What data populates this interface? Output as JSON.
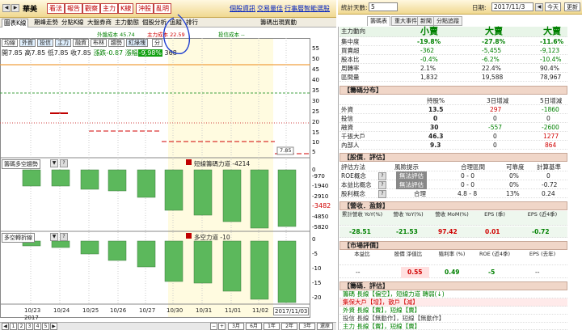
{
  "header": {
    "stock_name": "華美",
    "buttons": [
      "看法",
      "報告",
      "觀察",
      "主力",
      "K線",
      "沖股",
      "亂明"
    ],
    "links": [
      "個股資訊",
      "交易量佳",
      "行事曆",
      "智能選股"
    ]
  },
  "tabs": [
    "圖表K線",
    "期峰走勢",
    "分點K線",
    "大盤券商",
    "主力動態",
    "個股分析",
    "追蹤",
    "排行"
  ],
  "legend": {
    "item1": "外盤成本 45.74",
    "item2": "主力成本 22.59",
    "item3": "投信成本 --"
  },
  "chart_title": "籌碼出現異動",
  "toolbar": [
    "均線",
    "外資",
    "投信",
    "主力",
    "融資",
    "布林",
    "趨勢",
    "紅綠塊",
    "分"
  ],
  "price_line": {
    "open_label": "開",
    "open": "7.85",
    "high_label": "高",
    "high": "7.85",
    "low_label": "低",
    "low": "7.85",
    "close_label": "收",
    "close": "7.85",
    "change_label": "漲跌",
    "change": "-0.87",
    "pct_label": "漲幅",
    "pct": "-9.98%",
    "vol": "368"
  },
  "y_axis_price": [
    "55",
    "50",
    "45",
    "40",
    "35",
    "30",
    "25",
    "20",
    "15",
    "10",
    "5"
  ],
  "tag_price": "7.85",
  "panel2": {
    "select": "籌碼多空趨勢",
    "legend": "短線籌碼力道 -4214",
    "y": [
      "0",
      "-970",
      "-1940",
      "-2910",
      "-3482",
      "-4850",
      "-5820"
    ]
  },
  "panel3": {
    "select": "多空轉折線",
    "legend": "多空力道 -10",
    "y": [
      "0",
      "-5",
      "-10",
      "-15",
      "-20"
    ]
  },
  "x_axis": [
    "10/23",
    "10/24",
    "10/25",
    "10/26",
    "10/27",
    "10/30",
    "10/31",
    "11/01",
    "11/02"
  ],
  "x_year": "2017",
  "x_current": "2017/11/03",
  "bottom": {
    "pages": [
      "1",
      "2",
      "3",
      "4",
      "5"
    ],
    "ranges": [
      "3月",
      "6月",
      "1年",
      "2年",
      "3年",
      "還原"
    ]
  },
  "right": {
    "days_label": "統計天數:",
    "days": "5",
    "date_label": "日期:",
    "date": "2017/11/3",
    "today": "今天",
    "refresh": "更新",
    "rtabs": [
      "籌碼表",
      "重大事件",
      "新聞",
      "分點追蹤"
    ],
    "top_headers": [
      "小賣",
      "大賣",
      "大賣"
    ],
    "stats": [
      {
        "label": "主力動向",
        "v": [
          "",
          "",
          ""
        ]
      },
      {
        "label": "集中度",
        "v": [
          "-19.8%",
          "-27.8%",
          "-11.6%"
        ]
      },
      {
        "label": "買賣超",
        "v": [
          "-362",
          "-5,455",
          "-9,123"
        ]
      },
      {
        "label": "股本比",
        "v": [
          "-0.4%",
          "-6.2%",
          "-10.4%"
        ]
      },
      {
        "label": "周轉率",
        "v": [
          "2.1%",
          "22.4%",
          "90.4%"
        ]
      },
      {
        "label": "區間量",
        "v": [
          "1,832",
          "19,588",
          "78,967"
        ]
      }
    ],
    "sec1": "【籌碼分布】",
    "dist_headers": [
      "持股%",
      "3日增減",
      "5日增減"
    ],
    "dist": [
      {
        "label": "外資",
        "v": [
          "13.5",
          "297",
          "-1860"
        ]
      },
      {
        "label": "投信",
        "v": [
          "0",
          "0",
          "0"
        ]
      },
      {
        "label": "融資",
        "v": [
          "30",
          "-557",
          "-2600"
        ]
      },
      {
        "label": "千張大戶",
        "v": [
          "46.3",
          "0",
          "1277"
        ]
      },
      {
        "label": "內部人",
        "v": [
          "9.3",
          "0",
          "864"
        ]
      }
    ],
    "sec2": "【股價．評估】",
    "eval_headers": [
      "評估方法",
      "風險提示",
      "合理區間",
      "可靠度",
      "計算基準"
    ],
    "eval": [
      {
        "label": "ROE概念",
        "risk": "無法評估",
        "range": "0 - 0",
        "rel": "0%",
        "base": "0"
      },
      {
        "label": "本益比概念",
        "risk": "無法評估",
        "range": "0 - 0",
        "rel": "0%",
        "base": "-0.72"
      },
      {
        "label": "股利概念",
        "risk": "合理",
        "range": "4.8 - 8",
        "rel": "13%",
        "base": "0.24"
      }
    ],
    "sec3": "【營收．盈餘】",
    "rev_headers": [
      "累計營收 YoY(%)",
      "營收 YoY(%)",
      "營收 MoM(%)",
      "EPS (季)",
      "EPS (近4季)"
    ],
    "rev": [
      "-28.51",
      "-21.53",
      "97.42",
      "0.01",
      "-0.72"
    ],
    "sec4": "【市場評價】",
    "mkt_headers": [
      "本益比",
      "股價 淨值比",
      "殖利率 (%)",
      "ROE (近4季)",
      "EPS (去年)"
    ],
    "mkt": [
      "--",
      "0.55",
      "0.49",
      "-5",
      "--"
    ],
    "sec5": "【籌碼．評估】",
    "notes": [
      "籌碼 長線【偏空】，短線力道 轉弱(↓)",
      "集保大戶【增】，散戶【減】",
      "外資 長線【賣】，短線【賣】",
      "投信 長線【無動作】，短線【無動作】",
      "主力 長線【賣】，短線【賣】"
    ]
  }
}
